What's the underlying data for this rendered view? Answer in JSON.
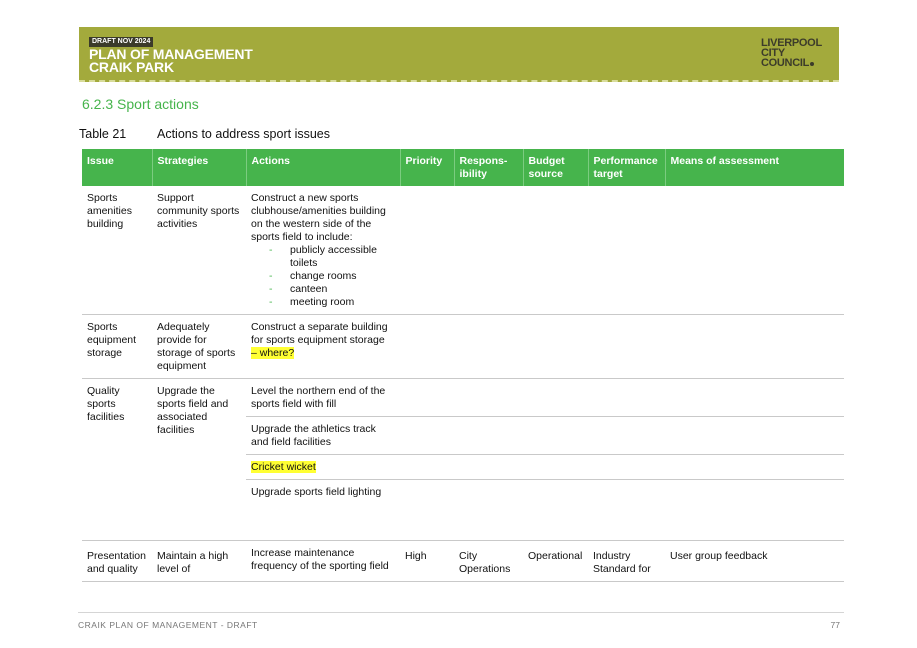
{
  "header": {
    "draft_tag": "DRAFT NOV 2024",
    "title_line1": "PLAN OF MANAGEMENT",
    "title_line2": "CRAIK PARK",
    "logo_line1": "LIVERPOOL",
    "logo_line2": "CITY",
    "logo_line3": "COUNCIL"
  },
  "section_heading": "6.2.3 Sport actions",
  "table_caption": {
    "number": "Table 21",
    "title": "Actions to address sport issues"
  },
  "table": {
    "columns": [
      "Issue",
      "Strategies",
      "Actions",
      "Priority",
      "Respons-ibility",
      "Budget source",
      "Performance target",
      "Means of assessment"
    ],
    "col_lines": {
      "responsibility_a": "Respons-",
      "responsibility_b": "ibility",
      "budget_a": "Budget",
      "budget_b": "source",
      "performance_a": "Performance",
      "performance_b": "target"
    },
    "rows": {
      "r1": {
        "issue": "Sports amenities building",
        "strategy": "Support community sports activities",
        "action": "Construct a new sports clubhouse/amenities building on the western side of the sports field to include:",
        "bullets": [
          "publicly accessible toilets",
          "change rooms",
          "canteen",
          "meeting room"
        ]
      },
      "r2": {
        "issue": "Sports equipment storage",
        "strategy": "Adequately provide for storage of sports equipment",
        "action": "Construct a separate building for sports equipment storage",
        "action_highlight": "– where?"
      },
      "r3": {
        "issue": "Quality sports facilities",
        "strategy": "Upgrade the sports field and associated facilities",
        "actions": [
          "Level the northern end of the sports field with fill",
          "Upgrade the athletics track and field facilities",
          "Cricket wicket",
          "Upgrade sports field lighting"
        ]
      },
      "r4": {
        "issue": "Presentation and quality",
        "strategy": "Maintain a high level of",
        "action": "Increase maintenance frequency of the sporting field",
        "priority": "High",
        "responsibility": "City Operations",
        "budget": "Operational",
        "performance": "Industry Standard for",
        "means": "User group feedback"
      }
    }
  },
  "footer": {
    "text": "CRAIK PLAN OF MANAGEMENT - DRAFT",
    "page": "77"
  },
  "colors": {
    "banner": "#a3aa3c",
    "table_header": "#46b44c",
    "heading": "#46b44c",
    "highlight": "#ffff33"
  }
}
